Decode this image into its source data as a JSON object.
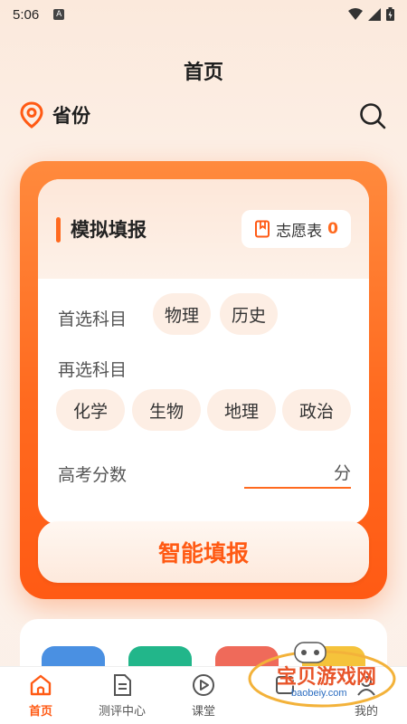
{
  "status_bar": {
    "time": "5:06",
    "notif_badge": "A"
  },
  "header": {
    "title": "首页"
  },
  "location": {
    "label": "省份"
  },
  "simulate": {
    "title": "模拟填报",
    "wish_label": "志愿表",
    "wish_count": "0",
    "first_subject_label": "首选科目",
    "first_subjects": [
      "物理",
      "历史"
    ],
    "second_subject_label": "再选科目",
    "second_subjects": [
      "化学",
      "生物",
      "地理",
      "政治"
    ],
    "score_label": "高考分数",
    "score_unit": "分",
    "submit_label": "智能填报"
  },
  "tabbar": {
    "items": [
      {
        "label": "首页",
        "icon": "home-icon",
        "active": true
      },
      {
        "label": "测评中心",
        "icon": "document-icon",
        "active": false
      },
      {
        "label": "课堂",
        "icon": "play-icon",
        "active": false
      },
      {
        "label": "",
        "icon": "info-icon",
        "active": false
      },
      {
        "label": "我的",
        "icon": "user-icon",
        "active": false
      }
    ]
  },
  "watermark": {
    "text": "宝贝游戏网",
    "url": "baobeiy.com"
  },
  "colors": {
    "accent": "#ff5a14",
    "chip_bg": "#fdeee4",
    "tile_blue": "#4a90e2",
    "tile_green": "#22b68a",
    "tile_red": "#ef6a5a",
    "tile_yellow": "#f5c33b"
  }
}
